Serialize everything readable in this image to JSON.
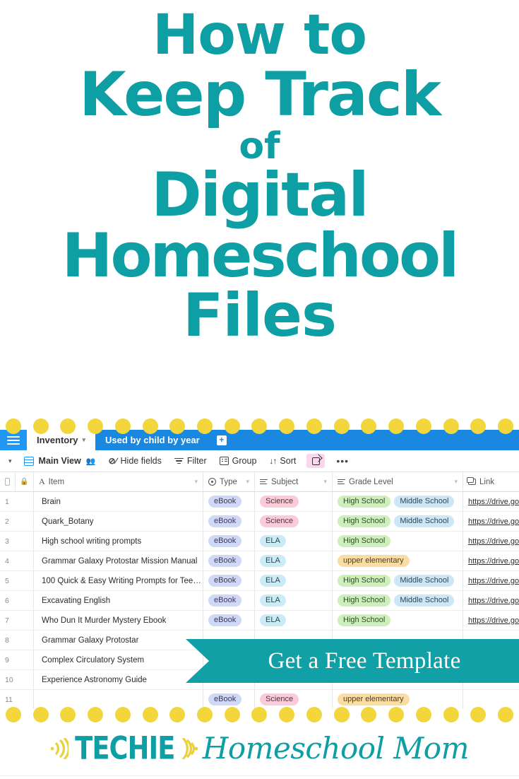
{
  "title": {
    "lines": [
      "How to",
      "Keep Track",
      "of",
      "Digital",
      "Homeschool",
      "Files"
    ],
    "color": "#0D9FA3"
  },
  "decor": {
    "dot_color": "#F2D63C",
    "dot_count_top": 19,
    "dot_count_bottom": 19
  },
  "cta": {
    "label": "Get a Free Template",
    "background": "#11A0A6",
    "text_color": "#FFFFFF"
  },
  "footer": {
    "logo_primary": "TECHIE",
    "logo_secondary": "Homeschool Mom",
    "teal": "#0D9FA3",
    "yellow": "#E8D13A"
  },
  "app": {
    "tabbar": {
      "background": "#2196F3",
      "menu_icon": "hamburger-icon",
      "tabs": [
        {
          "label": "Inventory",
          "active": true,
          "caret": "▾"
        },
        {
          "label": "Used by child by year",
          "active": false
        }
      ],
      "add_tab_label": "+"
    },
    "toolbar": {
      "collapse_caret": "▾",
      "view_name": "Main View",
      "collaborators_icon": "people-icon",
      "items": [
        {
          "label": "Hide fields",
          "icon": "hide-fields-icon"
        },
        {
          "label": "Filter",
          "icon": "filter-icon"
        },
        {
          "label": "Group",
          "icon": "group-icon"
        },
        {
          "label": "Sort",
          "icon": "sort-icon"
        }
      ],
      "share_icon": "share-external-icon",
      "share_bg": "#FBD7EE",
      "more_label": "•••"
    },
    "table": {
      "columns": [
        {
          "key": "item",
          "label": "Item",
          "icon": "text-field-icon",
          "has_caret": true
        },
        {
          "key": "type",
          "label": "Type",
          "icon": "single-select-icon",
          "has_caret": true
        },
        {
          "key": "subj",
          "label": "Subject",
          "icon": "multi-select-icon",
          "has_caret": true
        },
        {
          "key": "grade",
          "label": "Grade Level",
          "icon": "multi-select-icon",
          "has_caret": true
        },
        {
          "key": "link",
          "label": "Link",
          "icon": "link-field-icon",
          "has_caret": false
        }
      ],
      "link_value": "https://drive.googl",
      "rows": [
        {
          "n": "1",
          "item": "Brain",
          "type": "eBook",
          "subject": "Science",
          "grades": [
            "High School",
            "Middle School"
          ],
          "link": "https://drive.googl"
        },
        {
          "n": "2",
          "item": "Quark_Botany",
          "type": "eBook",
          "subject": "Science",
          "grades": [
            "High School",
            "Middle School"
          ],
          "link": "https://drive.googl"
        },
        {
          "n": "3",
          "item": "High school writing prompts",
          "type": "eBook",
          "subject": "ELA",
          "grades": [
            "High School"
          ],
          "link": "https://drive.googl"
        },
        {
          "n": "4",
          "item": "Grammar Galaxy Protostar Mission Manual",
          "type": "eBook",
          "subject": "ELA",
          "grades": [
            "upper elementary"
          ],
          "link": "https://drive.googl"
        },
        {
          "n": "5",
          "item": "100 Quick & Easy Writing Prompts for Tee…",
          "type": "eBook",
          "subject": "ELA",
          "grades": [
            "High School",
            "Middle School"
          ],
          "link": "https://drive.googl"
        },
        {
          "n": "6",
          "item": "Excavating English",
          "type": "eBook",
          "subject": "ELA",
          "grades": [
            "High School",
            "Middle School"
          ],
          "link": "https://drive.googl"
        },
        {
          "n": "7",
          "item": "Who Dun It Murder Mystery Ebook",
          "type": "eBook",
          "subject": "ELA",
          "grades": [
            "High School"
          ],
          "link": "https://drive.googl"
        },
        {
          "n": "8",
          "item": "Grammar Galaxy Protostar",
          "type": "",
          "subject": "",
          "grades": [],
          "link": ""
        },
        {
          "n": "9",
          "item": "Complex Circulatory System",
          "type": "",
          "subject": "",
          "grades": [],
          "link": ""
        },
        {
          "n": "10",
          "item": "Experience Astronomy Guide",
          "type": "",
          "subject": "",
          "grades": [],
          "link": ""
        },
        {
          "n": "11",
          "item": "",
          "type": "eBook",
          "subject": "Science",
          "grades": [
            "upper elementary"
          ],
          "link": ""
        }
      ],
      "tag_colors": {
        "eBook": "#CFD8F7",
        "Science": "#FBCBD9",
        "ELA": "#CBEBF7",
        "High School": "#CDEFBB",
        "Middle School": "#CDE7F7",
        "upper elementary": "#FBDDA4"
      }
    }
  }
}
